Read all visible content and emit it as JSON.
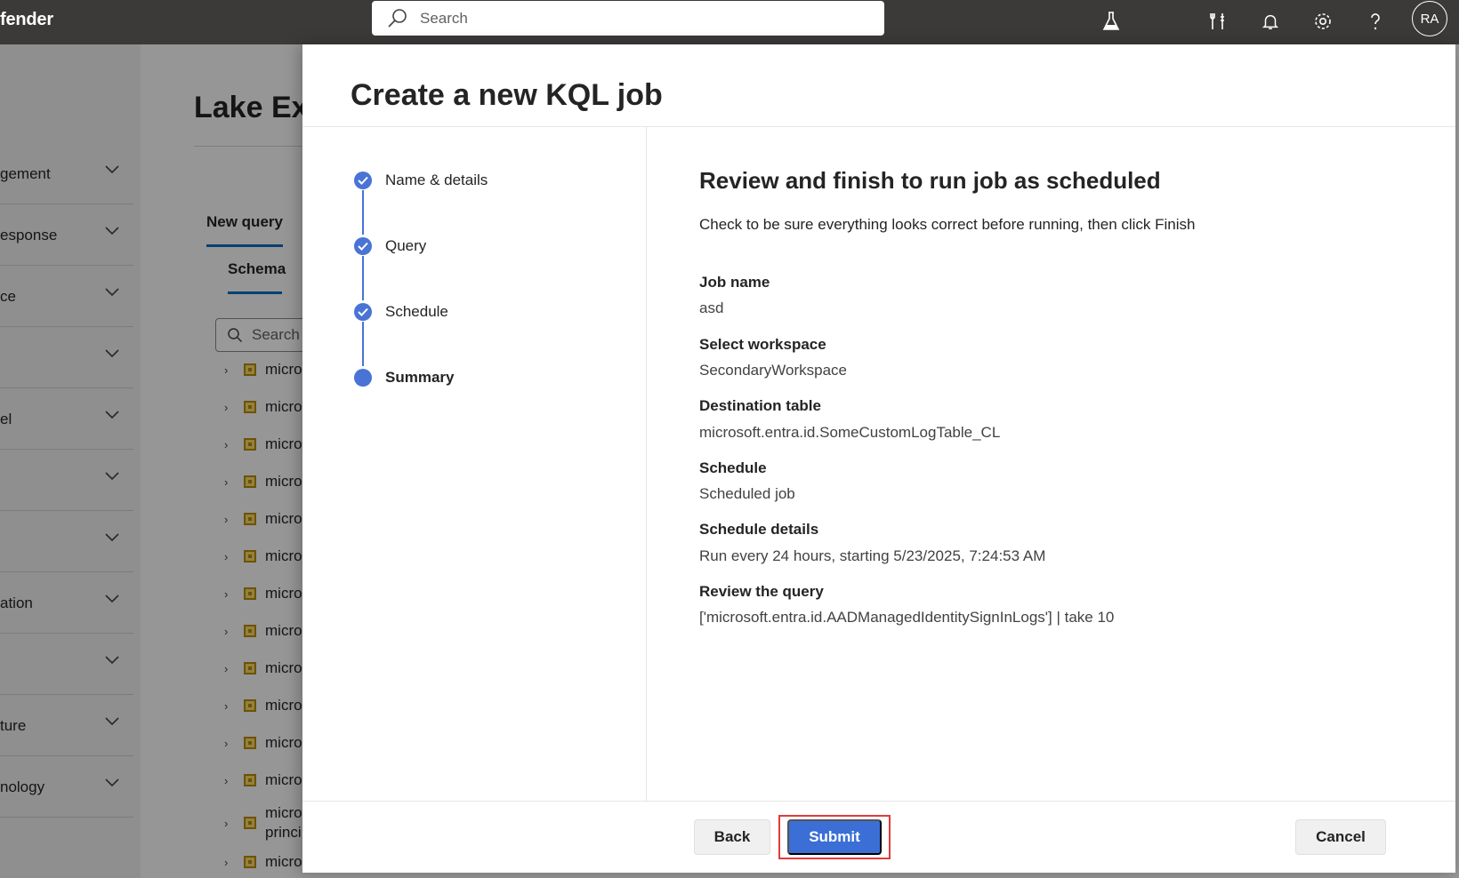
{
  "app": {
    "brand_text": "fender",
    "avatar_initials": "RA"
  },
  "topbar": {
    "search_placeholder": "Search",
    "icons": [
      "lab-flask-icon",
      "tools-icon",
      "bell-icon",
      "gear-icon",
      "help-icon"
    ]
  },
  "background": {
    "nav_items": [
      {
        "label": "gement"
      },
      {
        "label": "esponse"
      },
      {
        "label": "ce"
      },
      {
        "label": ""
      },
      {
        "label": "el"
      },
      {
        "label": ""
      },
      {
        "label": ""
      },
      {
        "label": "ation"
      },
      {
        "label": ""
      },
      {
        "label": "ture"
      },
      {
        "label": "nology"
      }
    ],
    "page_title": "Lake Ex",
    "tab_new_query": "New query",
    "tab_schema": "Schema",
    "schema_search_placeholder": "Search",
    "tree_items": [
      "micro",
      "micro",
      "micro",
      "micro",
      "micro",
      "micro",
      "micro",
      "micro",
      "micro",
      "micro",
      "micro",
      "micro",
      "micro",
      "micro"
    ],
    "tree_wrap_item": {
      "line1": "micro",
      "line2": "princi"
    }
  },
  "dialog": {
    "title": "Create a new KQL job",
    "steps": [
      {
        "label": "Name & details",
        "state": "complete"
      },
      {
        "label": "Query",
        "state": "complete"
      },
      {
        "label": "Schedule",
        "state": "complete"
      },
      {
        "label": "Summary",
        "state": "current"
      }
    ],
    "review_title": "Review and finish to run job as scheduled",
    "review_subtitle": "Check to be sure everything looks correct before running, then click Finish",
    "fields": [
      {
        "label": "Job name",
        "value": "asd"
      },
      {
        "label": "Select workspace",
        "value": "SecondaryWorkspace"
      },
      {
        "label": "Destination table",
        "value": "microsoft.entra.id.SomeCustomLogTable_CL"
      },
      {
        "label": "Schedule",
        "value": "Scheduled job"
      },
      {
        "label": "Schedule details",
        "value": "Run every 24 hours, starting 5/23/2025, 7:24:53 AM"
      },
      {
        "label": "Review the query",
        "value": "['microsoft.entra.id.AADManagedIdentitySignInLogs'] | take 10"
      }
    ],
    "buttons": {
      "back": "Back",
      "submit": "Submit",
      "cancel": "Cancel"
    }
  },
  "colors": {
    "accent": "#3b6fd6",
    "step": "#4a73d6",
    "highlight": "#e23a3a",
    "topbar": "#3b3a39"
  }
}
